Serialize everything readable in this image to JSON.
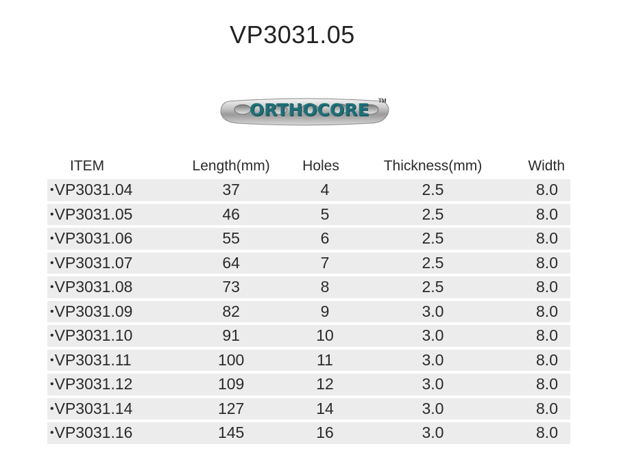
{
  "title": "VP3031.05",
  "logo": {
    "text": "ORTHOCORE",
    "tm": "TM",
    "color": "#1f6f78"
  },
  "table": {
    "headers": [
      "ITEM",
      "Length(mm)",
      "Holes",
      "Thickness(mm)",
      "Width"
    ],
    "bullet": "•",
    "rows": [
      [
        "VP3031.04",
        "37",
        "4",
        "2.5",
        "8.0"
      ],
      [
        "VP3031.05",
        "46",
        "5",
        "2.5",
        "8.0"
      ],
      [
        "VP3031.06",
        "55",
        "6",
        "2.5",
        "8.0"
      ],
      [
        "VP3031.07",
        "64",
        "7",
        "2.5",
        "8.0"
      ],
      [
        "VP3031.08",
        "73",
        "8",
        "2.5",
        "8.0"
      ],
      [
        "VP3031.09",
        "82",
        "9",
        "3.0",
        "8.0"
      ],
      [
        "VP3031.10",
        "91",
        "10",
        "3.0",
        "8.0"
      ],
      [
        "VP3031.11",
        "100",
        "11",
        "3.0",
        "8.0"
      ],
      [
        "VP3031.12",
        "109",
        "12",
        "3.0",
        "8.0"
      ],
      [
        "VP3031.14",
        "127",
        "14",
        "3.0",
        "8.0"
      ],
      [
        "VP3031.16",
        "145",
        "16",
        "3.0",
        "8.0"
      ]
    ],
    "row_color": "#ececec"
  }
}
